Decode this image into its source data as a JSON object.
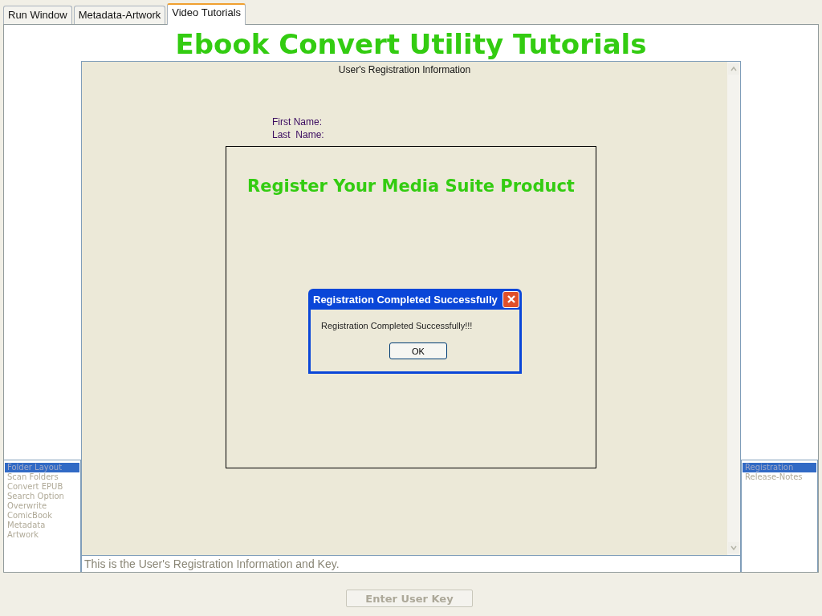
{
  "tabs": [
    {
      "label": "Run Window",
      "selected": false
    },
    {
      "label": "Metadata-Artwork",
      "selected": false
    },
    {
      "label": "Video Tutorials",
      "selected": true
    }
  ],
  "title": "Ebook Convert Utility Tutorials",
  "viewer": {
    "heading": "User's Registration Information",
    "fields": [
      "First Name:",
      "Last  Name:"
    ]
  },
  "overlay_panel": {
    "heading": "Register Your Media Suite Product"
  },
  "dialog": {
    "title": "Registration Completed Successfully",
    "message": "Registration Completed Successfully!!!",
    "button": "OK"
  },
  "left_list": [
    {
      "label": "Folder Layout",
      "selected": true
    },
    {
      "label": "Scan Folders",
      "selected": false
    },
    {
      "label": "Convert EPUB",
      "selected": false
    },
    {
      "label": "Search Option",
      "selected": false
    },
    {
      "label": "Overwrite",
      "selected": false
    },
    {
      "label": "ComicBook",
      "selected": false
    },
    {
      "label": "Metadata",
      "selected": false
    },
    {
      "label": "Artwork",
      "selected": false
    }
  ],
  "right_list": [
    {
      "label": "Registration",
      "selected": true
    },
    {
      "label": "Release-Notes",
      "selected": false
    }
  ],
  "description": "This is the User's Registration Information and Key.",
  "enter_key_button": {
    "label": "Enter User Key",
    "disabled": true
  }
}
